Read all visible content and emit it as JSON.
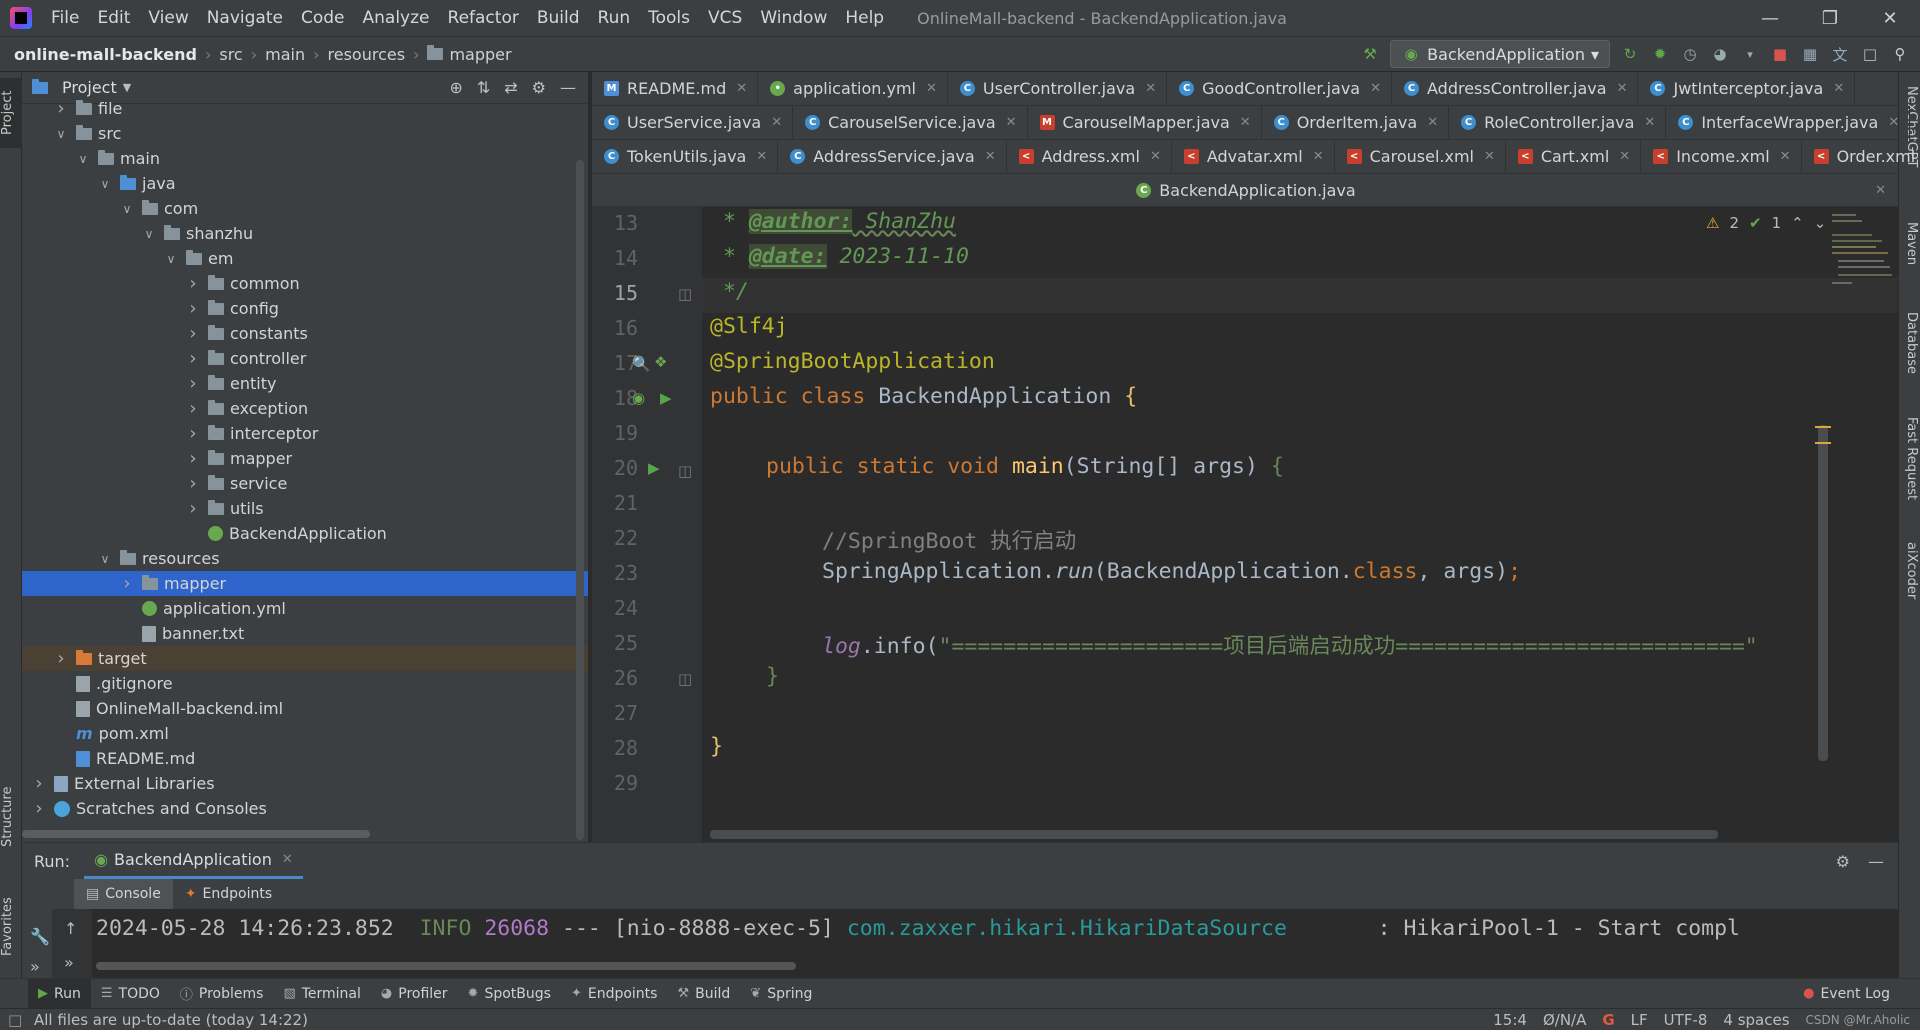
{
  "window": {
    "title": "OnlineMall-backend - BackendApplication.java",
    "menu": [
      "File",
      "Edit",
      "View",
      "Navigate",
      "Code",
      "Analyze",
      "Refactor",
      "Build",
      "Run",
      "Tools",
      "VCS",
      "Window",
      "Help"
    ]
  },
  "breadcrumb": [
    "online-mall-backend",
    "src",
    "main",
    "resources",
    "mapper"
  ],
  "run_config": "BackendApplication",
  "project_panel": {
    "title": "Project",
    "tree": [
      {
        "label": "file",
        "depth": 1,
        "arrow": "right",
        "icon": "folder"
      },
      {
        "label": "src",
        "depth": 1,
        "arrow": "down",
        "icon": "folder"
      },
      {
        "label": "main",
        "depth": 2,
        "arrow": "down",
        "icon": "folder"
      },
      {
        "label": "java",
        "depth": 3,
        "arrow": "down",
        "icon": "folder-blue"
      },
      {
        "label": "com",
        "depth": 4,
        "arrow": "down",
        "icon": "folder"
      },
      {
        "label": "shanzhu",
        "depth": 5,
        "arrow": "down",
        "icon": "folder"
      },
      {
        "label": "em",
        "depth": 6,
        "arrow": "down",
        "icon": "folder"
      },
      {
        "label": "common",
        "depth": 7,
        "arrow": "right",
        "icon": "folder"
      },
      {
        "label": "config",
        "depth": 7,
        "arrow": "right",
        "icon": "folder"
      },
      {
        "label": "constants",
        "depth": 7,
        "arrow": "right",
        "icon": "folder"
      },
      {
        "label": "controller",
        "depth": 7,
        "arrow": "right",
        "icon": "folder"
      },
      {
        "label": "entity",
        "depth": 7,
        "arrow": "right",
        "icon": "folder"
      },
      {
        "label": "exception",
        "depth": 7,
        "arrow": "right",
        "icon": "folder"
      },
      {
        "label": "interceptor",
        "depth": 7,
        "arrow": "right",
        "icon": "folder"
      },
      {
        "label": "mapper",
        "depth": 7,
        "arrow": "right",
        "icon": "folder"
      },
      {
        "label": "service",
        "depth": 7,
        "arrow": "right",
        "icon": "folder"
      },
      {
        "label": "utils",
        "depth": 7,
        "arrow": "right",
        "icon": "folder"
      },
      {
        "label": "BackendApplication",
        "depth": 7,
        "arrow": "none",
        "icon": "spring"
      },
      {
        "label": "resources",
        "depth": 3,
        "arrow": "down",
        "icon": "folder"
      },
      {
        "label": "mapper",
        "depth": 4,
        "arrow": "right",
        "icon": "folder",
        "selected": true
      },
      {
        "label": "application.yml",
        "depth": 4,
        "arrow": "none",
        "icon": "yml"
      },
      {
        "label": "banner.txt",
        "depth": 4,
        "arrow": "none",
        "icon": "file"
      },
      {
        "label": "target",
        "depth": 1,
        "arrow": "right",
        "icon": "folder-orange",
        "excluded": true
      },
      {
        "label": ".gitignore",
        "depth": 1,
        "arrow": "none",
        "icon": "file"
      },
      {
        "label": "OnlineMall-backend.iml",
        "depth": 1,
        "arrow": "none",
        "icon": "file"
      },
      {
        "label": "pom.xml",
        "depth": 1,
        "arrow": "none",
        "icon": "m"
      },
      {
        "label": "README.md",
        "depth": 1,
        "arrow": "none",
        "icon": "md"
      },
      {
        "label": "External Libraries",
        "depth": 0,
        "arrow": "right",
        "icon": "lib"
      },
      {
        "label": "Scratches and Consoles",
        "depth": 0,
        "arrow": "right",
        "icon": "scratch"
      }
    ]
  },
  "tabs": {
    "row1": [
      {
        "label": "README.md",
        "icon": "md"
      },
      {
        "label": "application.yml",
        "icon": "yml"
      },
      {
        "label": "UserController.java",
        "icon": "c"
      },
      {
        "label": "GoodController.java",
        "icon": "c"
      },
      {
        "label": "AddressController.java",
        "icon": "c"
      },
      {
        "label": "JwtInterceptor.java",
        "icon": "c"
      }
    ],
    "row2": [
      {
        "label": "UserService.java",
        "icon": "c"
      },
      {
        "label": "CarouselService.java",
        "icon": "c"
      },
      {
        "label": "CarouselMapper.java",
        "icon": "mapper"
      },
      {
        "label": "OrderItem.java",
        "icon": "c"
      },
      {
        "label": "RoleController.java",
        "icon": "c"
      },
      {
        "label": "InterfaceWrapper.java",
        "icon": "c"
      }
    ],
    "row3": [
      {
        "label": "TokenUtils.java",
        "icon": "c"
      },
      {
        "label": "AddressService.java",
        "icon": "c"
      },
      {
        "label": "Address.xml",
        "icon": "xml"
      },
      {
        "label": "Advatar.xml",
        "icon": "xml"
      },
      {
        "label": "Carousel.xml",
        "icon": "xml"
      },
      {
        "label": "Cart.xml",
        "icon": "xml"
      },
      {
        "label": "Income.xml",
        "icon": "xml"
      },
      {
        "label": "Order.xml",
        "icon": "xml"
      }
    ],
    "active": "BackendApplication.java"
  },
  "editor": {
    "line_numbers": [
      "13",
      "14",
      "15",
      "16",
      "17",
      "18",
      "19",
      "20",
      "21",
      "22",
      "23",
      "24",
      "25",
      "26",
      "27",
      "28",
      "29"
    ],
    "current_line": "15",
    "inspections": {
      "warnings": "2",
      "weak_warnings": "1"
    },
    "code": {
      "l13_star": " * ",
      "l13_tag": "@author:",
      "l13_val": " ShanZhu",
      "l14_star": " * ",
      "l14_tag": "@date:",
      "l14_val": " 2023-11-10",
      "l15": " */",
      "l16": "@Slf4j",
      "l17": "@SpringBootApplication",
      "l18_kw": "public class ",
      "l18_name": "BackendApplication ",
      "l18_br": "{",
      "l20_kw": "public static void ",
      "l20_fn": "main",
      "l20_rest": "(String[] args) ",
      "l20_br": "{",
      "l22": "//SpringBoot 执行启动",
      "l23_a": "SpringApplication.",
      "l23_run": "run",
      "l23_b": "(BackendApplication.",
      "l23_cls": "class",
      "l23_c": ", args)",
      "l23_semi": ";",
      "l25_log": "log",
      "l25_dot": ".info(",
      "l25_str": "\"=====================项目后端启动成功===========================\"",
      "l26": "}",
      "l28": "}"
    }
  },
  "run_panel": {
    "label": "Run:",
    "tab": "BackendApplication",
    "subtabs": [
      "Console",
      "Endpoints"
    ],
    "log": {
      "timestamp": "2024-05-28 14:26:23.852",
      "level": "INFO",
      "pid": "26068",
      "sep": "---",
      "thread": "[nio-8888-exec-5]",
      "logger": "com.zaxxer.hikari.HikariDataSource",
      "message": ": HikariPool-1 - Start compl"
    }
  },
  "tool_windows": [
    "Run",
    "TODO",
    "Problems",
    "Terminal",
    "Profiler",
    "SpotBugs",
    "Endpoints",
    "Build",
    "Spring"
  ],
  "event_log": "Event Log",
  "left_strip": [
    "Project",
    "Structure",
    "Favorites"
  ],
  "right_strip": [
    "NexChatGPT",
    "Maven",
    "Database",
    "Fast Request",
    "aiXcoder"
  ],
  "status": {
    "message": "All files are up-to-date (today 14:22)",
    "position": "15:4",
    "vcs": "Ø/N/A",
    "line_sep": "LF",
    "encoding": "UTF-8",
    "indent": "4 spaces",
    "watermark": "CSDN @Mr.Aholic"
  },
  "colors": {
    "accent": "#4a88c7",
    "selection": "#2f65ca",
    "bg": "#2b2b2b",
    "panel": "#3c3f41"
  }
}
